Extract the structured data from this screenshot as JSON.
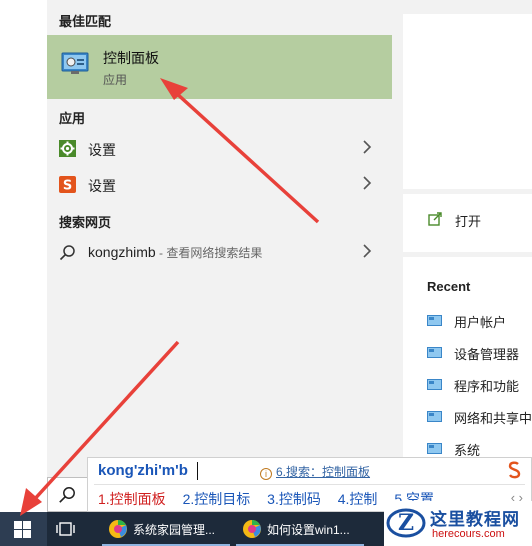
{
  "start_menu": {
    "best_match_header": "最佳匹配",
    "best_match": {
      "title": "控制面板",
      "subtitle": "应用"
    },
    "apps_header": "应用",
    "apps": [
      {
        "label": "设置",
        "icon": "gear-icon"
      },
      {
        "label": "设置",
        "icon": "sogou-s-icon"
      }
    ],
    "web_header": "搜索网页",
    "web_result": {
      "query": "kongzhimb",
      "hint": " - 查看网络搜索结果"
    }
  },
  "preview": {
    "open_label": "打开",
    "recent_title": "Recent",
    "recent_items": [
      "用户帐户",
      "设备管理器",
      "程序和功能",
      "网络和共享中",
      "系统"
    ]
  },
  "ime": {
    "pinyin": "kong'zhi'm'b",
    "search_hint": "6.搜索：控制面板",
    "candidates": [
      "1.控制面板",
      "2.控制目标",
      "3.控制码",
      "4.控制",
      "5.空置"
    ],
    "nav": "‹  ›"
  },
  "taskbar": {
    "apps": [
      {
        "label": "系统家园管理..."
      },
      {
        "label": "如何设置win1..."
      }
    ]
  },
  "watermark": {
    "title": "这里教程网",
    "url": "herecours.com"
  },
  "colors": {
    "best_match_bg": "#b5cda0",
    "menu_bg": "#f2f2f2",
    "taskbar_bg": "#1d2a3a",
    "arrow_red": "#e8413a",
    "ime_blue": "#1a56b8",
    "ime_red": "#d01f1f"
  }
}
